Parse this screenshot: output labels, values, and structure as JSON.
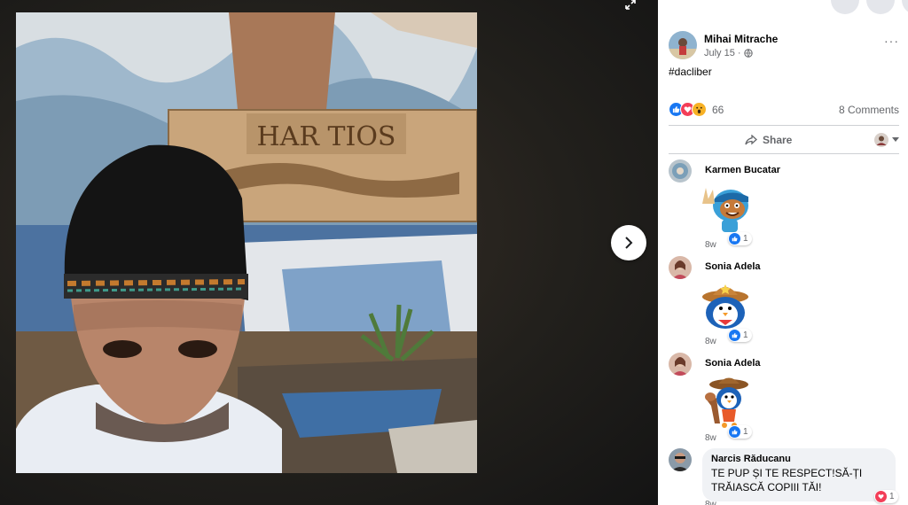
{
  "post": {
    "author": "Mihai Mitrache",
    "date": "July 15 ·",
    "text": "#dacliber",
    "reactions_count": "66",
    "comments_count": "8 Comments",
    "share_label": "Share",
    "more_label": "···"
  },
  "photo": {
    "sign_text": "HAR TIOS"
  },
  "comments": [
    {
      "name": "Karmen Bucatar",
      "time": "8w",
      "likes": "1",
      "sticker": "thumbs-up-cartoon-sticker"
    },
    {
      "name": "Sonia Adela",
      "time": "8w",
      "likes": "1",
      "sticker": "cowboy-penguin-sticker"
    },
    {
      "name": "Sonia Adela",
      "time": "8w",
      "likes": "1",
      "sticker": "cowboy-penguin-horse-sticker"
    },
    {
      "name": "Narcis Răducanu",
      "time": "8w",
      "likes": "1",
      "text": "TE PUP ȘI TE RESPECT!SĂ-ȚI TRĂIASCĂ COPIII TĂI!"
    }
  ],
  "colors": {
    "accent": "#1877f2",
    "love": "#f33e58",
    "haha": "#f7b125"
  }
}
